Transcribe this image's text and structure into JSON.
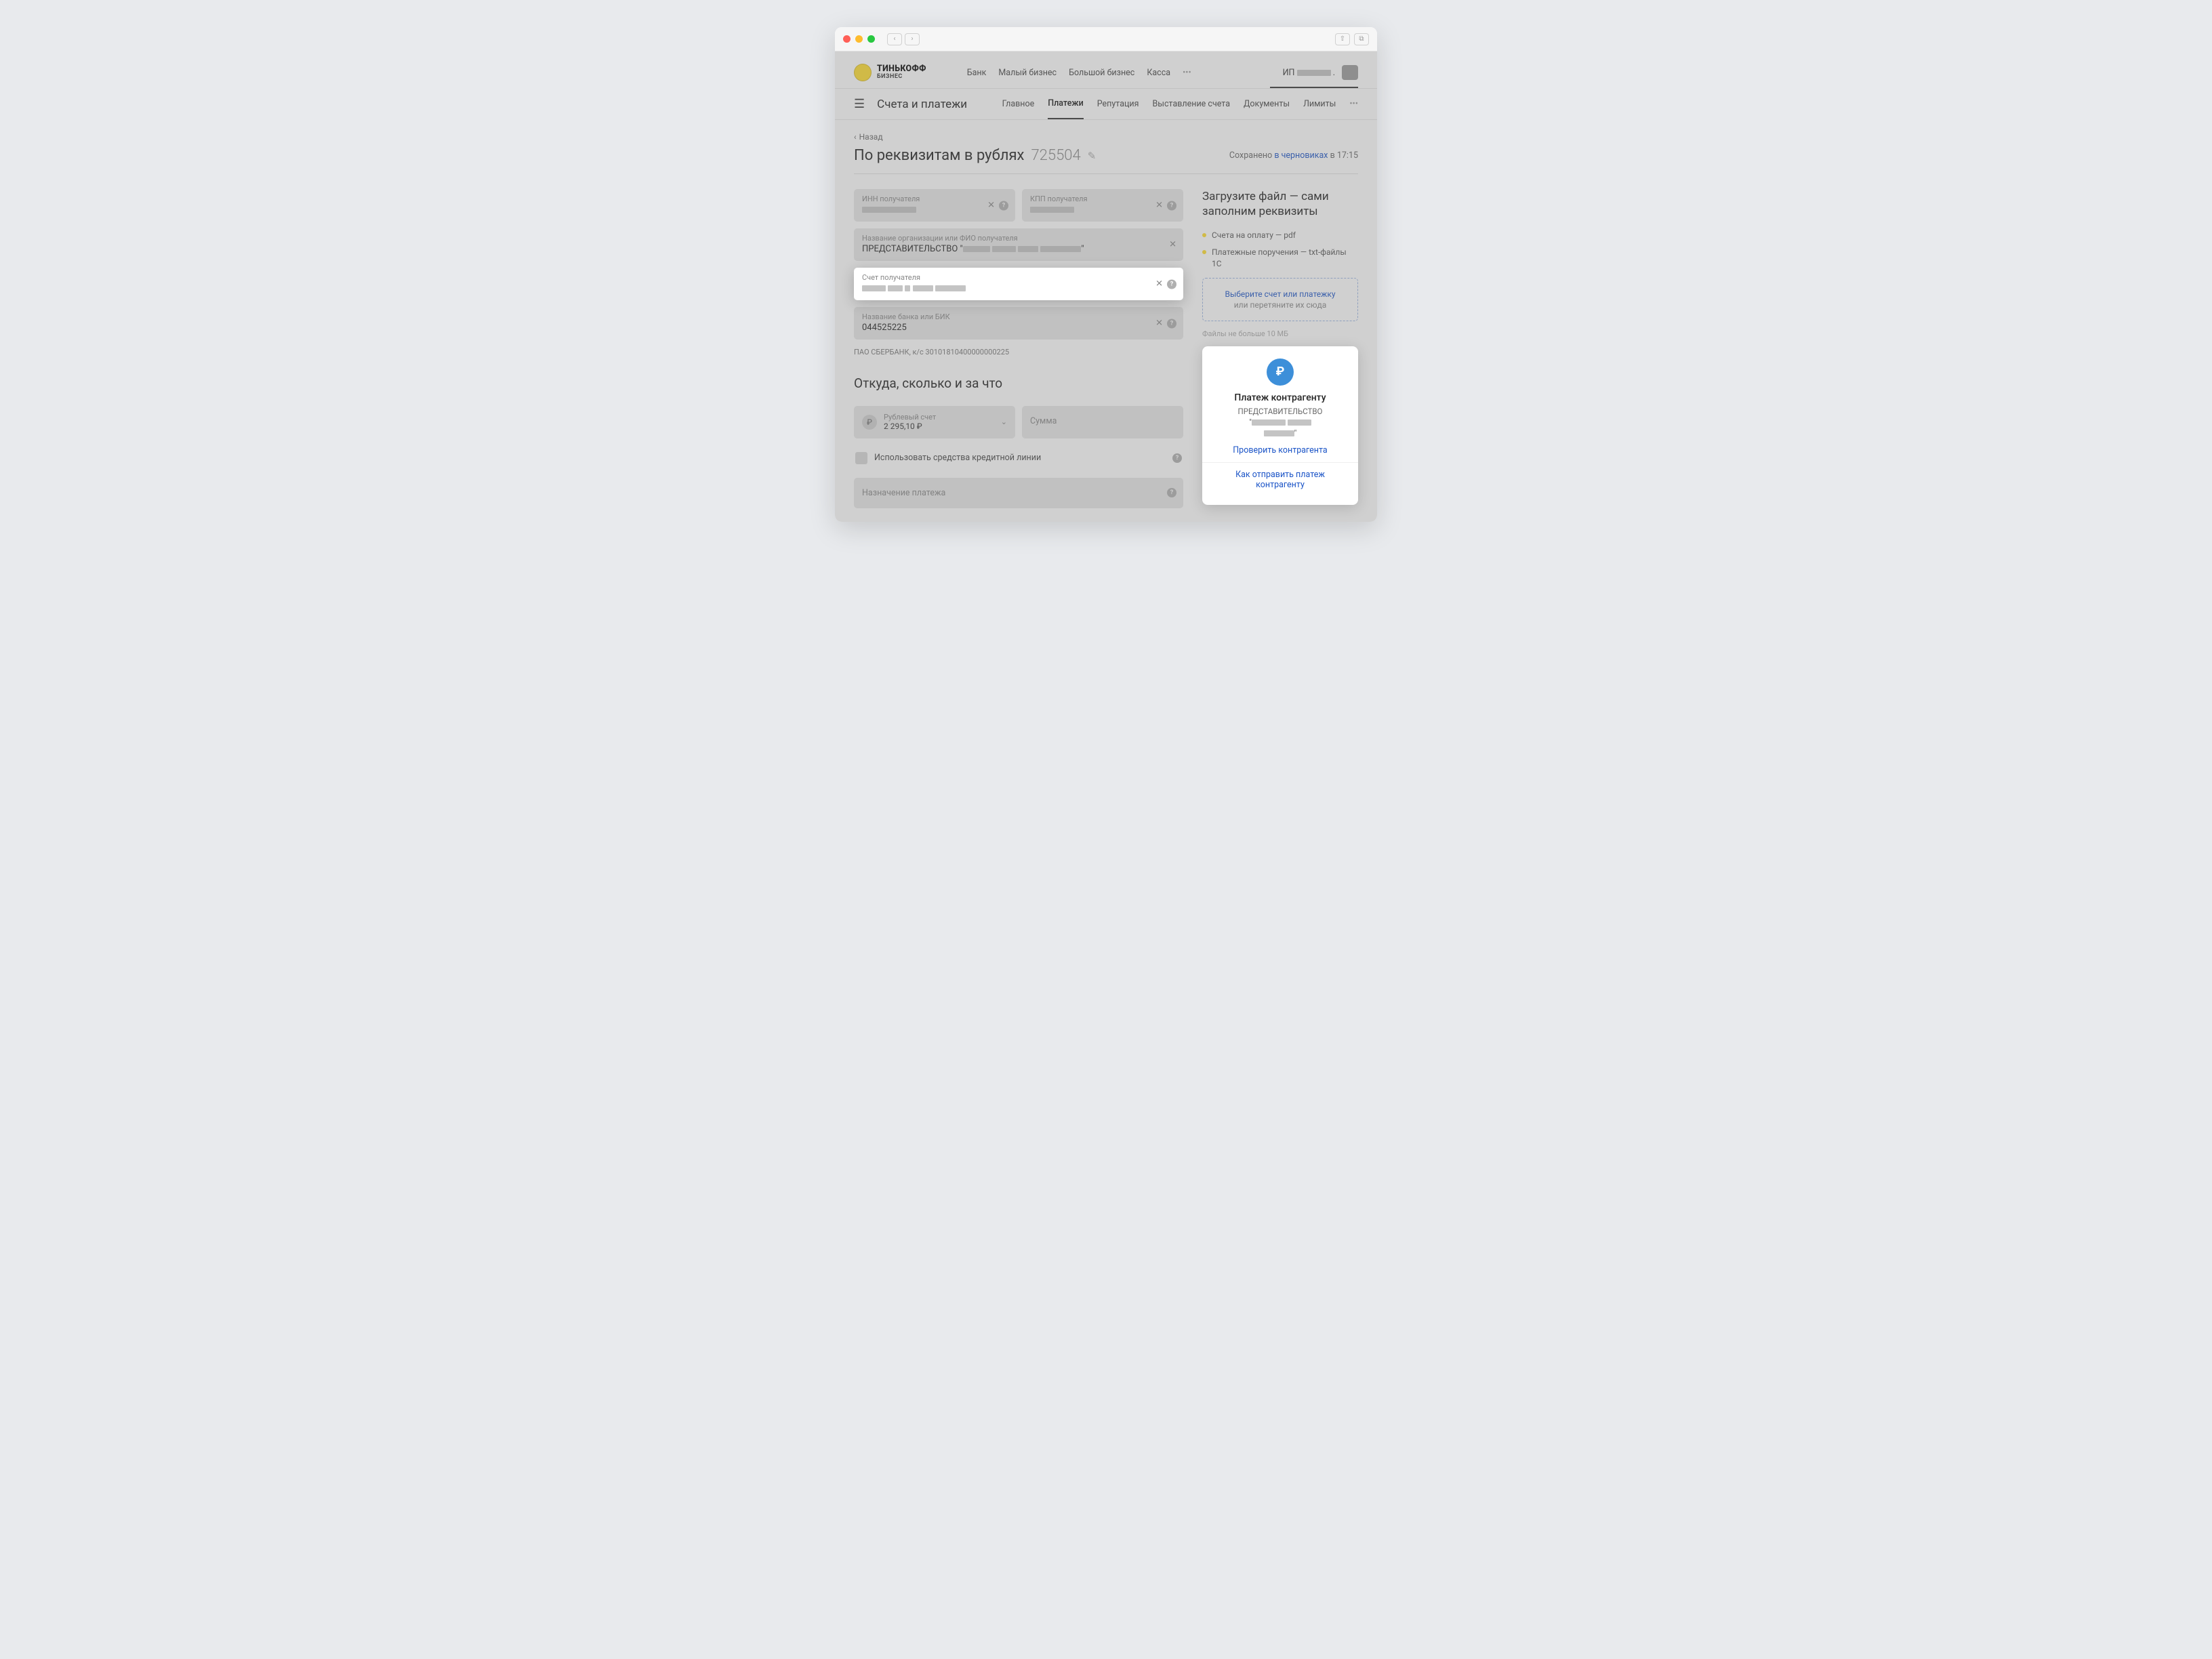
{
  "logo": {
    "main": "ТИНЬКОФФ",
    "sub": "БИЗНЕС"
  },
  "topNav": {
    "items": [
      "Банк",
      "Малый бизнес",
      "Большой бизнес",
      "Касса"
    ]
  },
  "user": {
    "prefix": "ИП",
    "suffix": "."
  },
  "subheader": {
    "title": "Счета и платежи",
    "nav": [
      "Главное",
      "Платежи",
      "Репутация",
      "Выставление счета",
      "Документы",
      "Лимиты"
    ],
    "activeIndex": 1
  },
  "back": "Назад",
  "pageTitle": {
    "text": "По реквизитам в рублях",
    "num": "725504"
  },
  "saved": {
    "prefix": "Сохранено ",
    "link": "в черновиках",
    "suffix": " в 17:15"
  },
  "fields": {
    "inn": {
      "label": "ИНН получателя"
    },
    "kpp": {
      "label": "КПП получателя"
    },
    "org": {
      "label": "Название организации или ФИО получателя",
      "value": "ПРЕДСТАВИТЕЛЬСТВО \"",
      "valueSuffix": "\""
    },
    "account": {
      "label": "Счет получателя"
    },
    "bank": {
      "label": "Название банка или БИК",
      "value": "044525225"
    },
    "bankLine": "ПАО СБЕРБАНК, к/с 30101810400000000225"
  },
  "section2": {
    "title": "Откуда, сколько и за что",
    "acct": {
      "label": "Рублевый счет",
      "value": "2 295,10 ₽"
    },
    "sum": "Сумма",
    "credit": "Использовать средства кредитной линии",
    "purpose": "Назначение платежа"
  },
  "side": {
    "title": "Загрузите файл — сами заполним реквизиты",
    "bullets": [
      "Счета на оплату — pdf",
      "Платежные поручения — txt-файлы 1С"
    ],
    "dropzone": {
      "link": "Выберите счет или платежку",
      "sub": "или перетяните их сюда"
    },
    "note": "Файлы не больше 10 МБ"
  },
  "card": {
    "title": "Платеж контрагенту",
    "org": "ПРЕДСТАВИТЕЛЬСТВО",
    "link1": "Проверить контрагента",
    "link2": "Как отправить платеж контрагенту"
  }
}
